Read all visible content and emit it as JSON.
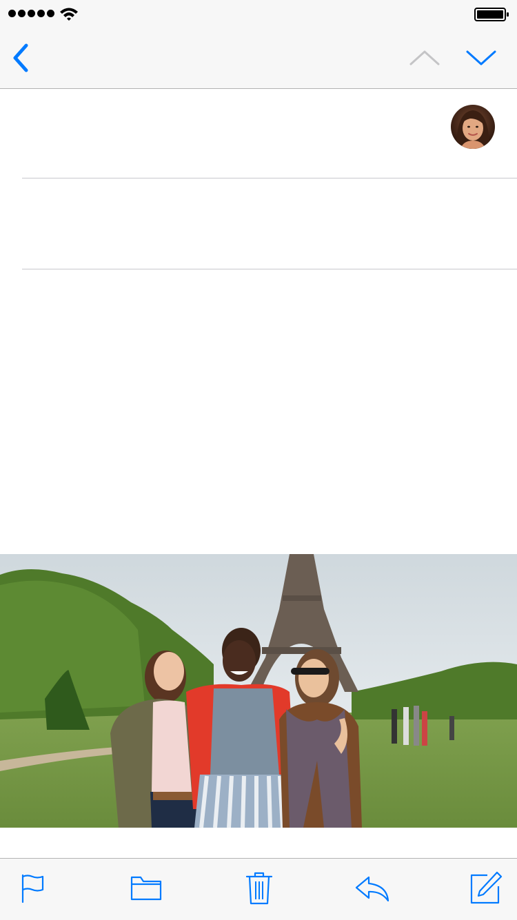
{
  "status_bar": {
    "signal_bars": 5,
    "icons": [
      "signal-dots",
      "wifi-icon",
      "battery-icon"
    ],
    "battery_level": 1.0
  },
  "nav_bar": {
    "icons": [
      "back-chevron-icon",
      "chevron-up-icon",
      "chevron-down-icon"
    ],
    "colors": {
      "accent": "#007aff",
      "disabled": "#c4c4c6"
    }
  },
  "message": {
    "avatar_icon": "sender-avatar"
  },
  "toolbar": {
    "icons": [
      "flag-icon",
      "folder-icon",
      "trash-icon",
      "reply-icon",
      "compose-icon"
    ]
  },
  "colors": {
    "bar_background": "#f7f7f7",
    "separator": "#c8c7cc",
    "accent": "#007aff"
  }
}
